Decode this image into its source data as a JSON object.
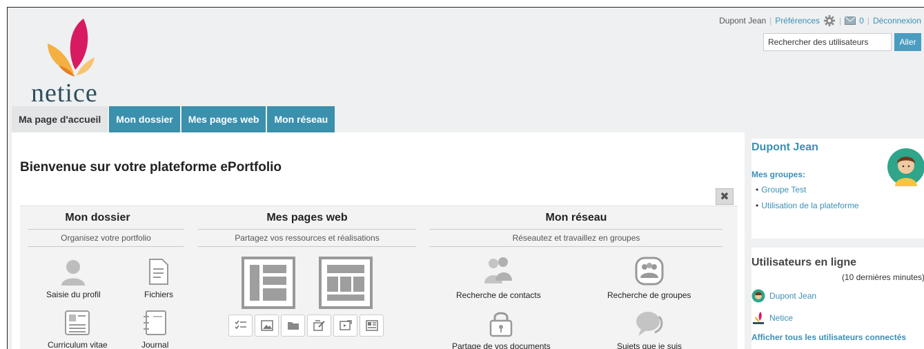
{
  "header": {
    "logo_text": "netice",
    "user_name": "Dupont Jean",
    "preferences": "Préférences",
    "message_count": "0",
    "logout": "Déconnexion",
    "search_placeholder": "Rechercher des utilisateurs",
    "search_button": "Aller"
  },
  "tabs": [
    {
      "label": "Ma page d'accueil",
      "active": true
    },
    {
      "label": "Mon dossier"
    },
    {
      "label": "Mes pages web"
    },
    {
      "label": "Mon réseau"
    }
  ],
  "main": {
    "welcome": "Bienvenue sur votre plateforme ePortfolio",
    "close": "✖",
    "columns": [
      {
        "title": "Mon dossier",
        "subtitle": "Organisez votre portfolio",
        "items": [
          "Saisie du profil",
          "Fichiers",
          "Curriculum vitae",
          "Journal"
        ]
      },
      {
        "title": "Mes pages web",
        "subtitle": "Partagez vos ressources et réalisations",
        "items": []
      },
      {
        "title": "Mon réseau",
        "subtitle": "Réseautez et travaillez en groupes",
        "items": [
          "Recherche de contacts",
          "Recherche de groupes",
          "Partage de vos documents",
          "Sujets que je suis"
        ]
      }
    ]
  },
  "sidebar": {
    "profile_name": "Dupont Jean",
    "groups_label": "Mes groupes:",
    "groups": [
      "Groupe Test",
      "Utilisation de la plateforme"
    ],
    "online_title": "Utilisateurs en ligne",
    "online_subtitle": "(10 dernières minutes)",
    "online_users": [
      "Dupont Jean",
      "Netice"
    ],
    "show_all": "Afficher tous les utilisateurs connectés"
  },
  "colors": {
    "accent": "#3a8fb6",
    "tab": "#3a90ad",
    "button": "#4a9cc0"
  }
}
